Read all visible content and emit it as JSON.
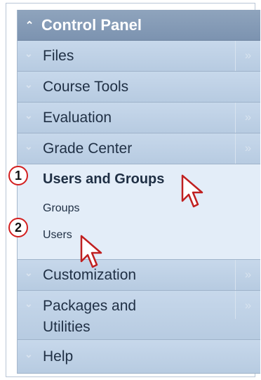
{
  "panel": {
    "title": "Control Panel",
    "header_icon": "double-chevron-up-icon"
  },
  "menu": {
    "items": [
      {
        "label": "Files",
        "has_more": true
      },
      {
        "label": "Course Tools",
        "has_more": false
      },
      {
        "label": "Evaluation",
        "has_more": true
      },
      {
        "label": "Grade Center",
        "has_more": true
      },
      {
        "label": "Users and Groups",
        "expanded": true,
        "children": [
          {
            "label": "Groups"
          },
          {
            "label": "Users"
          }
        ]
      },
      {
        "label": "Customization",
        "has_more": true
      },
      {
        "label": "Packages and Utilities",
        "label_line1": "Packages and",
        "label_line2": "Utilities",
        "has_more": true
      },
      {
        "label": "Help",
        "has_more": false
      }
    ],
    "chevron_glyph": "≫",
    "row_chevron_glyph": "»"
  },
  "annotations": {
    "steps": [
      "1",
      "2"
    ],
    "step_badge_color": "#d31f1f"
  },
  "colors": {
    "header_bg": "#7c93b0",
    "row_bg": "#bccfe3",
    "expanded_bg": "#e3edf8",
    "text": "#1f2f44"
  }
}
